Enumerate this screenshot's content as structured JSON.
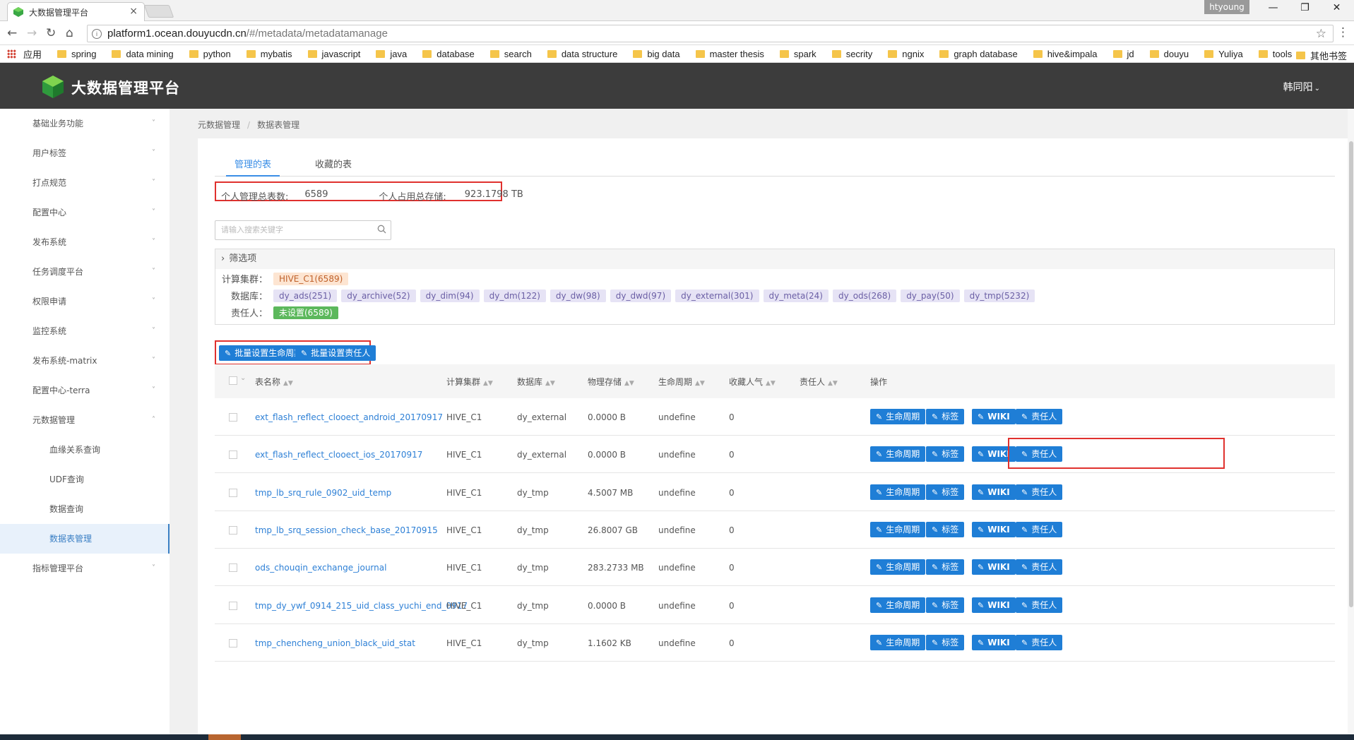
{
  "browser": {
    "tab_title": "大数据管理平台",
    "tab_close": "×",
    "profile_name": "htyoung",
    "url_host": "platform1.ocean.douyucdn.cn",
    "url_path": "/#/metadata/metadatamanage",
    "bookmarks": [
      "应用",
      "spring",
      "data mining",
      "python",
      "mybatis",
      "javascript",
      "java",
      "database",
      "search",
      "data structure",
      "big data",
      "master thesis",
      "spark",
      "secrity",
      "ngnix",
      "graph database",
      "hive&impala",
      "jd",
      "douyu",
      "Yuliya",
      "tools"
    ],
    "other_bookmarks": "其他书签"
  },
  "header": {
    "title": "大数据管理平台",
    "user": "韩同阳"
  },
  "sidebar": {
    "items": [
      "基础业务功能",
      "用户标签",
      "打点规范",
      "配置中心",
      "发布系统",
      "任务调度平台",
      "权限申请",
      "监控系统",
      "发布系统-matrix",
      "配置中心-terra",
      "元数据管理"
    ],
    "subitems": [
      "血缘关系查询",
      "UDF查询",
      "数据查询",
      "数据表管理"
    ],
    "after": "指标管理平台"
  },
  "breadcrumb": [
    "元数据管理",
    "数据表管理"
  ],
  "tabs": [
    "管理的表",
    "收藏的表"
  ],
  "stats": {
    "total_label": "个人管理总表数:",
    "total_value": "6589",
    "storage_label": "个人占用总存储:",
    "storage_value": "923.1798 TB"
  },
  "search": {
    "placeholder": "请输入搜索关键字"
  },
  "filter": {
    "title": "筛选项",
    "cluster_label": "计算集群：",
    "clusters": [
      "HIVE_C1(6589)"
    ],
    "db_label": "数据库：",
    "databases": [
      "dy_ads(251)",
      "dy_archive(52)",
      "dy_dim(94)",
      "dy_dm(122)",
      "dy_dw(98)",
      "dy_dwd(97)",
      "dy_external(301)",
      "dy_meta(24)",
      "dy_ods(268)",
      "dy_pay(50)",
      "dy_tmp(5232)"
    ],
    "owner_label": "责任人：",
    "owners": [
      "未设置(6589)"
    ]
  },
  "batch_buttons": [
    "批量设置生命周期",
    "批量设置责任人"
  ],
  "table": {
    "columns": [
      "表名称",
      "计算集群",
      "数据库",
      "物理存储",
      "生命周期",
      "收藏人气",
      "责任人",
      "操作"
    ],
    "actions": [
      "生命周期",
      "标签",
      "WIKI",
      "责任人"
    ],
    "rows": [
      {
        "name": "ext_flash_reflect_clooect_android_20170917",
        "cluster": "HIVE_C1",
        "db": "dy_external",
        "storage": "0.0000 B",
        "life": "undefine",
        "fav": "0"
      },
      {
        "name": "ext_flash_reflect_clooect_ios_20170917",
        "cluster": "HIVE_C1",
        "db": "dy_external",
        "storage": "0.0000 B",
        "life": "undefine",
        "fav": "0"
      },
      {
        "name": "tmp_lb_srq_rule_0902_uid_temp",
        "cluster": "HIVE_C1",
        "db": "dy_tmp",
        "storage": "4.5007 MB",
        "life": "undefine",
        "fav": "0"
      },
      {
        "name": "tmp_lb_srq_session_check_base_20170915",
        "cluster": "HIVE_C1",
        "db": "dy_tmp",
        "storage": "26.8007 GB",
        "life": "undefine",
        "fav": "0"
      },
      {
        "name": "ods_chouqin_exchange_journal",
        "cluster": "HIVE_C1",
        "db": "dy_tmp",
        "storage": "283.2733 MB",
        "life": "undefine",
        "fav": "0"
      },
      {
        "name": "tmp_dy_ywf_0914_215_uid_class_yuchi_end_0917",
        "cluster": "HIVE_C1",
        "db": "dy_tmp",
        "storage": "0.0000 B",
        "life": "undefine",
        "fav": "0"
      },
      {
        "name": "tmp_chencheng_union_black_uid_stat",
        "cluster": "HIVE_C1",
        "db": "dy_tmp",
        "storage": "1.1602 KB",
        "life": "undefine",
        "fav": "0"
      }
    ]
  },
  "colors": {
    "accent": "#1f7ed6",
    "link": "#2e80d6",
    "highlight": "#e0312e",
    "header_bg": "#3c3c3c"
  }
}
